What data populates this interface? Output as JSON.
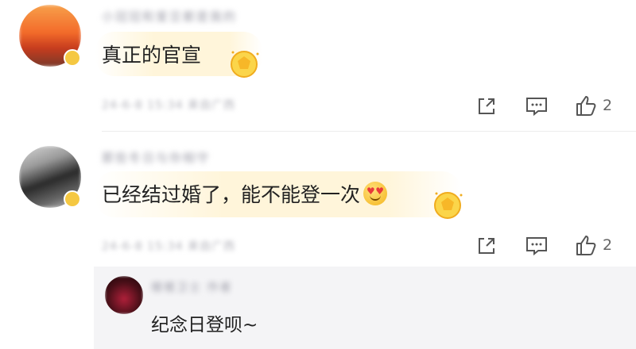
{
  "comments": [
    {
      "username": "小冠冠和爱豆都是我的",
      "text": "真正的官宣",
      "meta": "24-6-8 15:34 来自广西",
      "actions": {
        "like_count": "2"
      }
    },
    {
      "username": "那些冬日与你相守",
      "text": "已经结过婚了，能不能登一次",
      "meta": "24-6-8 15:34 来自广西",
      "actions": {
        "like_count": "2"
      }
    }
  ],
  "reply": {
    "username": "楼楼卫士 作者",
    "text": "纪念日登呗~"
  },
  "icons": {
    "share": "share-icon",
    "comment": "comment-icon",
    "like": "thumbs-up-icon",
    "medal": "gold-medal-icon",
    "emoji": "heart-eyes-emoji-icon"
  },
  "colors": {
    "medal": "#f5c842",
    "text": "#222222",
    "muted": "#9a9aa6"
  }
}
